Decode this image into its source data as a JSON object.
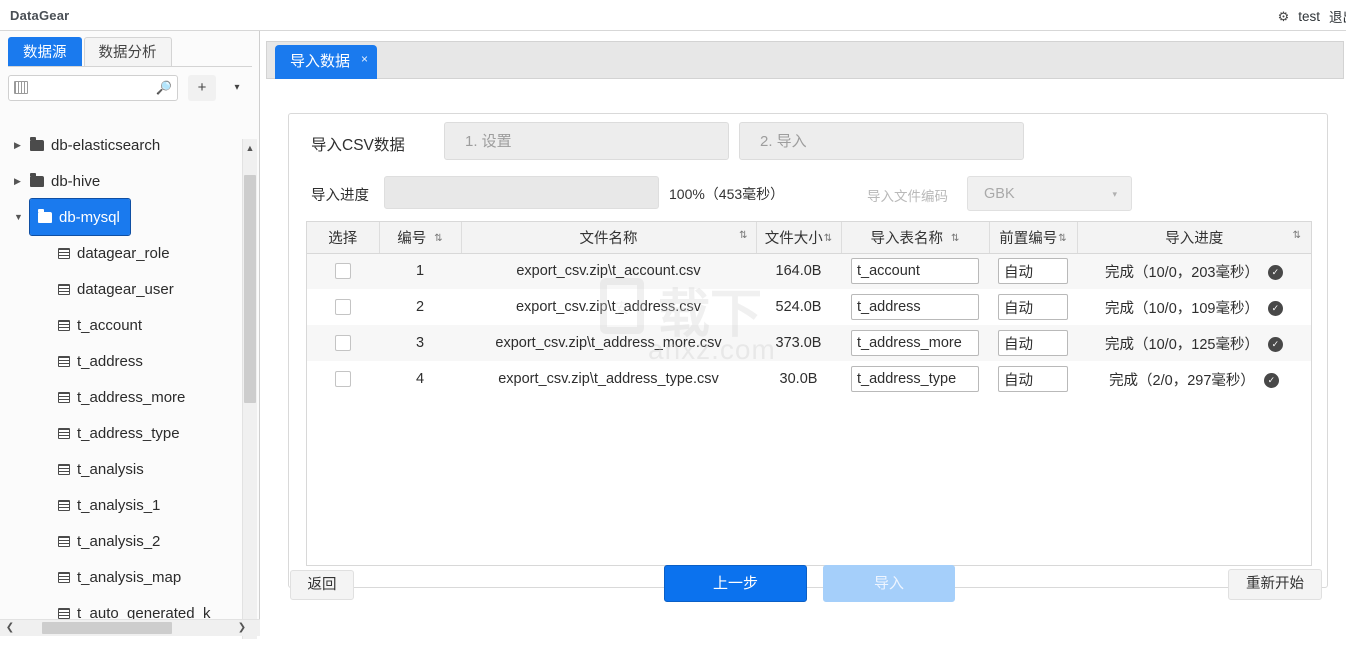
{
  "app": {
    "brand": "DataGear",
    "gear_icon": "gear-icon",
    "user": "test",
    "logout": "退出"
  },
  "sidebar": {
    "tabs": [
      {
        "label": "数据源",
        "active": true
      },
      {
        "label": "数据分析",
        "active": false
      }
    ],
    "search": {
      "value": "",
      "placeholder": "",
      "ime_icon": "keyboard-icon",
      "search_icon": "search-icon"
    },
    "add_button": "+",
    "more_button": "▾",
    "tree": [
      {
        "label": "db-elasticsearch",
        "type": "folder",
        "expanded": false,
        "selected": false,
        "indent": 0
      },
      {
        "label": "db-hive",
        "type": "folder",
        "expanded": false,
        "selected": false,
        "indent": 0
      },
      {
        "label": "db-mysql",
        "type": "folder",
        "expanded": true,
        "selected": true,
        "indent": 0
      },
      {
        "label": "datagear_role",
        "type": "table",
        "indent": 1
      },
      {
        "label": "datagear_user",
        "type": "table",
        "indent": 1
      },
      {
        "label": "t_account",
        "type": "table",
        "indent": 1
      },
      {
        "label": "t_address",
        "type": "table",
        "indent": 1
      },
      {
        "label": "t_address_more",
        "type": "table",
        "indent": 1
      },
      {
        "label": "t_address_type",
        "type": "table",
        "indent": 1
      },
      {
        "label": "t_analysis",
        "type": "table",
        "indent": 1
      },
      {
        "label": "t_analysis_1",
        "type": "table",
        "indent": 1
      },
      {
        "label": "t_analysis_2",
        "type": "table",
        "indent": 1
      },
      {
        "label": "t_analysis_map",
        "type": "table",
        "indent": 1
      },
      {
        "label": "t_auto_generated_k",
        "type": "table",
        "indent": 1
      }
    ]
  },
  "workspace": {
    "tab": {
      "label": "导入数据",
      "close": "×",
      "active": true
    }
  },
  "import": {
    "title": "导入CSV数据",
    "steps": [
      {
        "label": "1. 设置",
        "active": false
      },
      {
        "label": "2. 导入",
        "active": false
      }
    ],
    "progress_label": "导入进度",
    "progress_percent": "100%",
    "progress_text": "100%（453毫秒）",
    "progress_value": 0,
    "encoding_label": "导入文件编码",
    "encoding_value": "GBK",
    "encoding_caret": "▾",
    "table": {
      "columns": [
        {
          "label": "选择",
          "sortable": false
        },
        {
          "label": "编号",
          "sortable": true
        },
        {
          "label": "文件名称",
          "sortable": true
        },
        {
          "label": "文件大小",
          "sortable": true
        },
        {
          "label": "导入表名称",
          "sortable": true
        },
        {
          "label": "前置编号",
          "sortable": true
        },
        {
          "label": "导入进度",
          "sortable": true
        }
      ],
      "sort_icon": "⇅",
      "rows": [
        {
          "checked": false,
          "no": "1",
          "file": "export_csv.zip\\t_account.csv",
          "size": "164.0B",
          "table_name": "t_account",
          "pre_no": "自动",
          "progress": "完成（10/0，203毫秒）",
          "status_icon": "check-circle-icon"
        },
        {
          "checked": false,
          "no": "2",
          "file": "export_csv.zip\\t_address.csv",
          "size": "524.0B",
          "table_name": "t_address",
          "pre_no": "自动",
          "progress": "完成（10/0，109毫秒）",
          "status_icon": "check-circle-icon"
        },
        {
          "checked": false,
          "no": "3",
          "file": "export_csv.zip\\t_address_more.csv",
          "size": "373.0B",
          "table_name": "t_address_more",
          "pre_no": "自动",
          "progress": "完成（10/0，125毫秒）",
          "status_icon": "check-circle-icon"
        },
        {
          "checked": false,
          "no": "4",
          "file": "export_csv.zip\\t_address_type.csv",
          "size": "30.0B",
          "table_name": "t_address_type",
          "pre_no": "自动",
          "progress": "完成（2/0，297毫秒）",
          "status_icon": "check-circle-icon"
        }
      ]
    },
    "buttons": {
      "back": "返回",
      "prev": "上一步",
      "import": "导入",
      "restart": "重新开始"
    }
  },
  "watermark": {
    "cn": "载下",
    "site": "anxz.com",
    "badge": "安"
  }
}
